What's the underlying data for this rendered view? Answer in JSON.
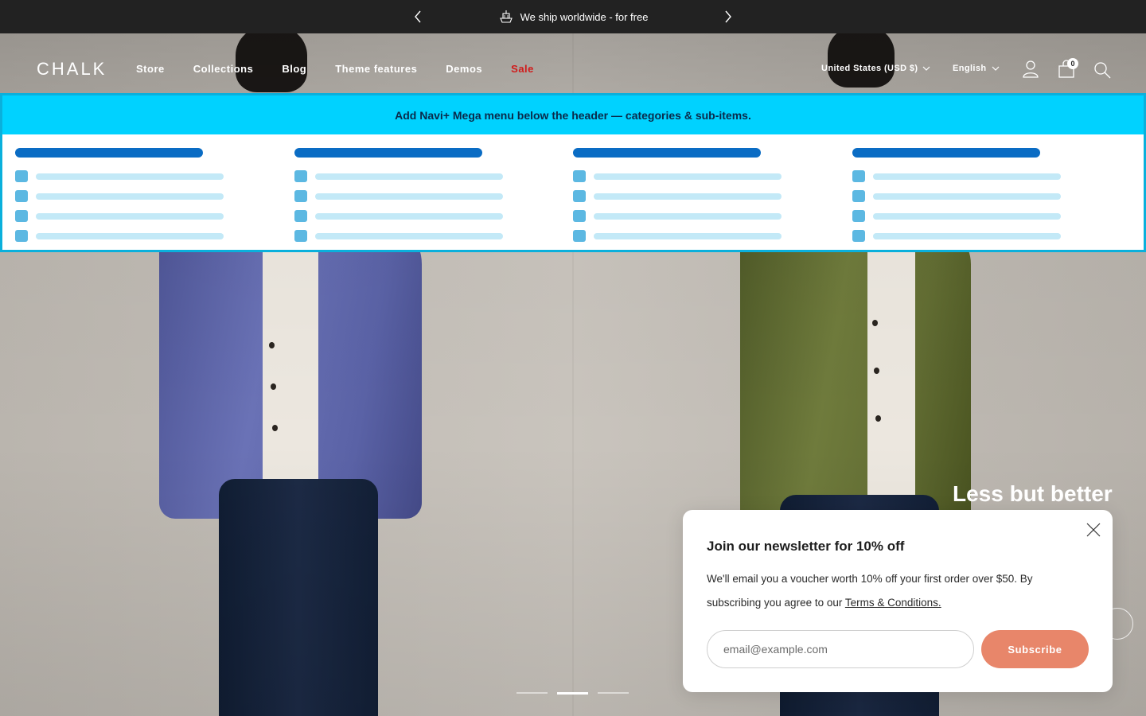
{
  "announcement": {
    "message": "We ship worldwide - for free",
    "icon": "ship-icon"
  },
  "header": {
    "logo": "CHALK",
    "nav": [
      "Store",
      "Collections",
      "Blog",
      "Theme features",
      "Demos",
      "Sale"
    ],
    "country_selector": "United States (USD $)",
    "language_selector": "English",
    "cart_count": "0",
    "sale_color": "#d11a1a"
  },
  "mega_menu": {
    "banner_text": "Add Navi+ Mega menu below the header — categories & sub-items.",
    "banner_color": "#00d2ff",
    "columns": 4,
    "rows_per_column": 4
  },
  "hero": {
    "title": "Less but better"
  },
  "slider": {
    "slides": 3,
    "active": 2
  },
  "newsletter": {
    "title": "Join our newsletter for 10% off",
    "body": "We'll email you a voucher worth 10% off your first order over $50. By subscribing you agree to our ",
    "terms_link": "Terms & Conditions.",
    "email_placeholder": "email@example.com",
    "subscribe_label": "Subscribe",
    "button_color": "#e8866a"
  }
}
